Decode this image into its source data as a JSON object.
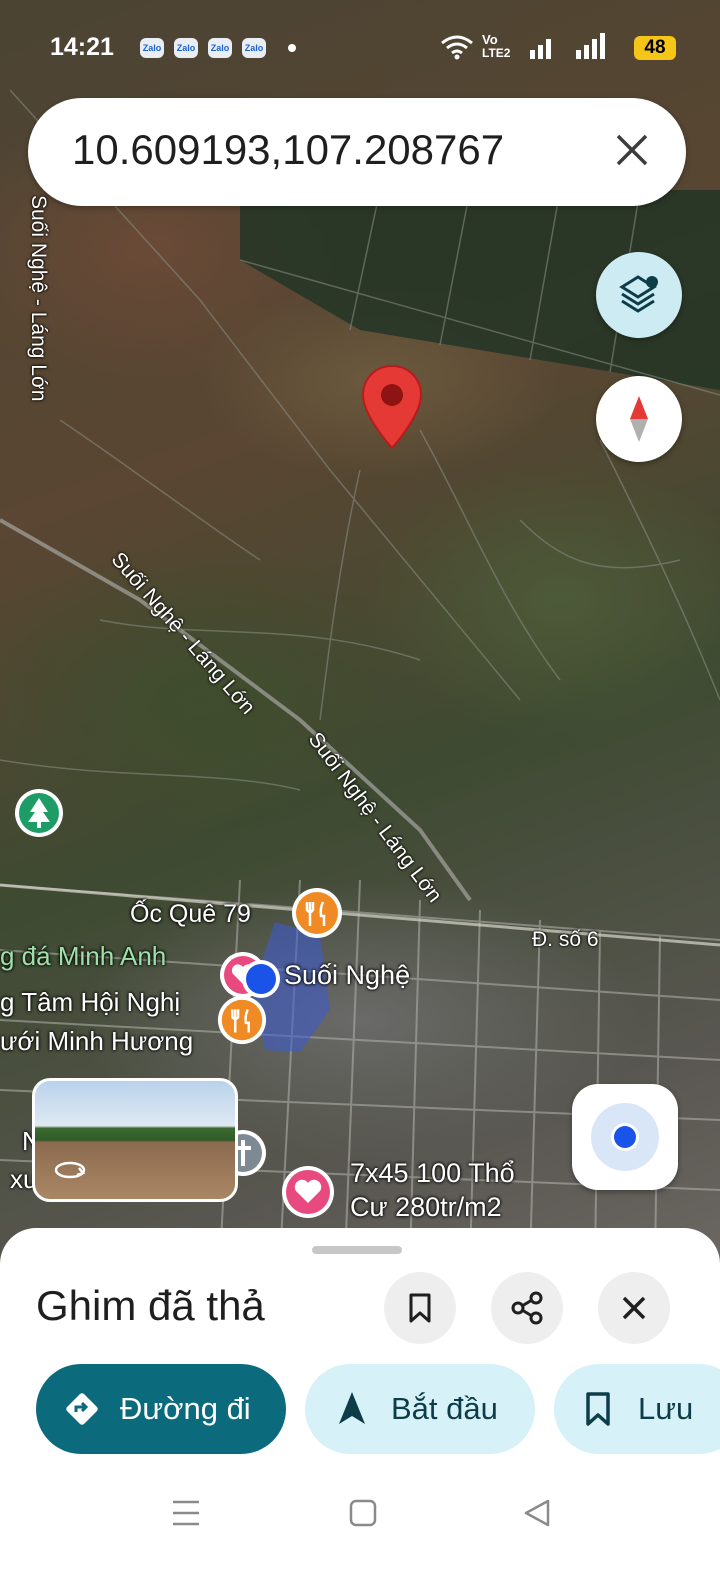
{
  "status": {
    "time": "14:21",
    "notification_apps": [
      "Zalo",
      "Zalo",
      "Zalo",
      "Zalo"
    ],
    "network_label_1": "Vo",
    "network_label_2": "LTE2",
    "battery": "48"
  },
  "search": {
    "query": "10.609193,107.208767"
  },
  "map": {
    "road_labels": [
      "Suối Nghệ - Láng Lớn",
      "Suối Nghệ - Láng Lớn",
      "Suối Nghệ - Láng Lớn",
      "Đ. số 6"
    ],
    "places": {
      "restaurant_1": "Ốc Quê 79",
      "place_2": "g đá Minh Anh",
      "town": "Suối Nghệ",
      "conference_1": "g Tâm Hội Nghị",
      "conference_2": "ưới Minh Hương",
      "listing": "7x45 100 Thổ Cư 280tr/m2",
      "partial_1": "N",
      "partial_2": "xu"
    },
    "accent_pin_color": "#e53935"
  },
  "sheet": {
    "title": "Ghim đã thả",
    "directions_label": "Đường đi",
    "start_label": "Bắt đầu",
    "save_label": "Lưu"
  },
  "colors": {
    "primary": "#0b6b7c",
    "chip": "#d6f1f7",
    "layer_fab": "#cdebf2"
  }
}
